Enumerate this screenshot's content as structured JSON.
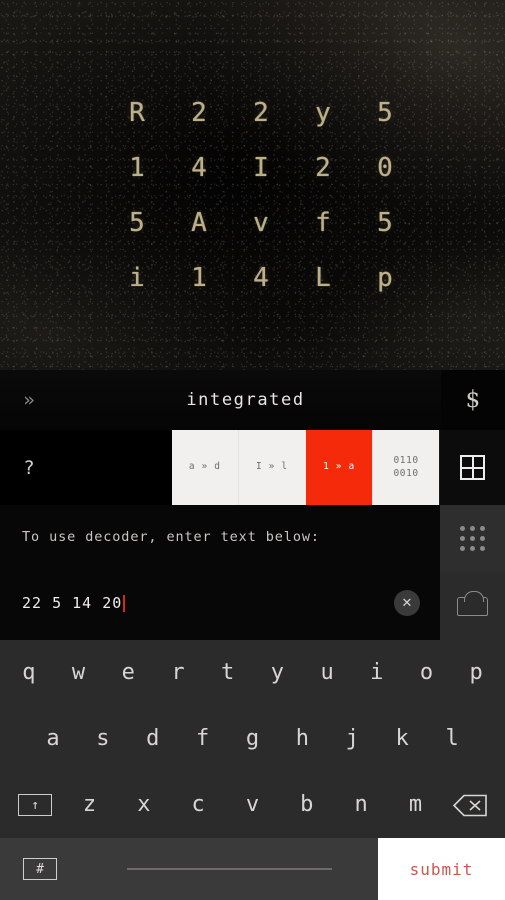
{
  "puzzle": {
    "rows": [
      [
        "R",
        "2",
        "2",
        "y",
        "5"
      ],
      [
        "1",
        "4",
        "I",
        "2",
        "0"
      ],
      [
        "5",
        "A",
        "v",
        "f",
        "5"
      ],
      [
        "i",
        "1",
        "4",
        "L",
        "p"
      ]
    ]
  },
  "header": {
    "back_label": "»",
    "title": "integrated",
    "currency_label": "$"
  },
  "modes": {
    "help_label": "?",
    "buttons": [
      {
        "label": "a » d",
        "active": false
      },
      {
        "label": "I » l",
        "active": false
      },
      {
        "label": "1 » a",
        "active": true
      },
      {
        "label": "0110",
        "label2": "0010",
        "active": false
      }
    ],
    "grid_icon": "window-grid-icon"
  },
  "decoder": {
    "prompt": "To use decoder, enter text below:",
    "input_value": "22 5 14 20",
    "input_placeholder": "",
    "clear_label": "✕"
  },
  "rail": {
    "dots_icon": "apps-grid-icon",
    "cloud_icon": "cloud-upload-icon"
  },
  "keyboard": {
    "row1": [
      "q",
      "w",
      "e",
      "r",
      "t",
      "y",
      "u",
      "i",
      "o",
      "p"
    ],
    "row2": [
      "a",
      "s",
      "d",
      "f",
      "g",
      "h",
      "j",
      "k",
      "l"
    ],
    "row3": [
      "z",
      "x",
      "c",
      "v",
      "b",
      "n",
      "m"
    ],
    "shift_label": "↑",
    "backspace_label": "backspace-icon",
    "numeric_label": "#",
    "space_label": "",
    "submit_label": "submit"
  },
  "colors": {
    "accent_red": "#f42a0a",
    "submit_red": "#c9584a",
    "caret_red": "#d9271a",
    "puzzle_text": "#cbbd93",
    "keyboard_bg": "#2b2b2b"
  }
}
